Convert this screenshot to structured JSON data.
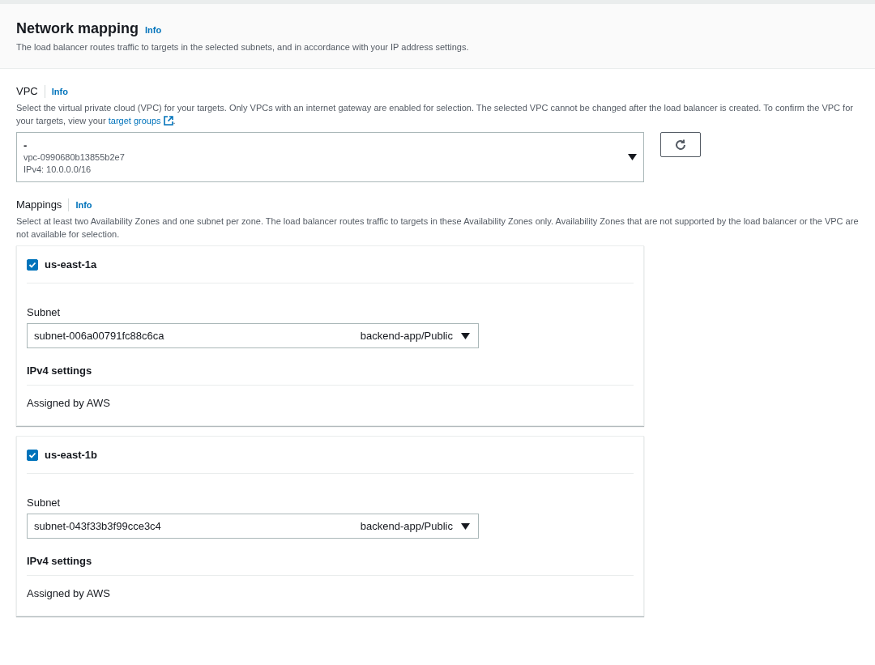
{
  "header": {
    "title": "Network mapping",
    "info": "Info",
    "description": "The load balancer routes traffic to targets in the selected subnets, and in accordance with your IP address settings."
  },
  "vpc": {
    "label": "VPC",
    "info": "Info",
    "description": "Select the virtual private cloud (VPC) for your targets. Only VPCs with an internet gateway are enabled for selection. The selected VPC cannot be changed after the load balancer is created. To confirm the VPC for your targets, view your",
    "link": "target groups",
    "description_end": ".",
    "select": {
      "value": "-",
      "id": "vpc-0990680b13855b2e7",
      "cidr": "IPv4: 10.0.0.0/16"
    }
  },
  "mappings": {
    "label": "Mappings",
    "info": "Info",
    "description": "Select at least two Availability Zones and one subnet per zone. The load balancer routes traffic to targets in these Availability Zones only. Availability Zones that are not supported by the load balancer or the VPC are not available for selection.",
    "zones": [
      {
        "name": "us-east-1a",
        "checked": true,
        "subnet_label": "Subnet",
        "subnet": "subnet-006a00791fc88c6ca",
        "subnet_tag": "backend-app/Public",
        "ipv4_heading": "IPv4 settings",
        "ipv4_value": "Assigned by AWS"
      },
      {
        "name": "us-east-1b",
        "checked": true,
        "subnet_label": "Subnet",
        "subnet": "subnet-043f33b3f99cce3c4",
        "subnet_tag": "backend-app/Public",
        "ipv4_heading": "IPv4 settings",
        "ipv4_value": "Assigned by AWS"
      }
    ]
  }
}
